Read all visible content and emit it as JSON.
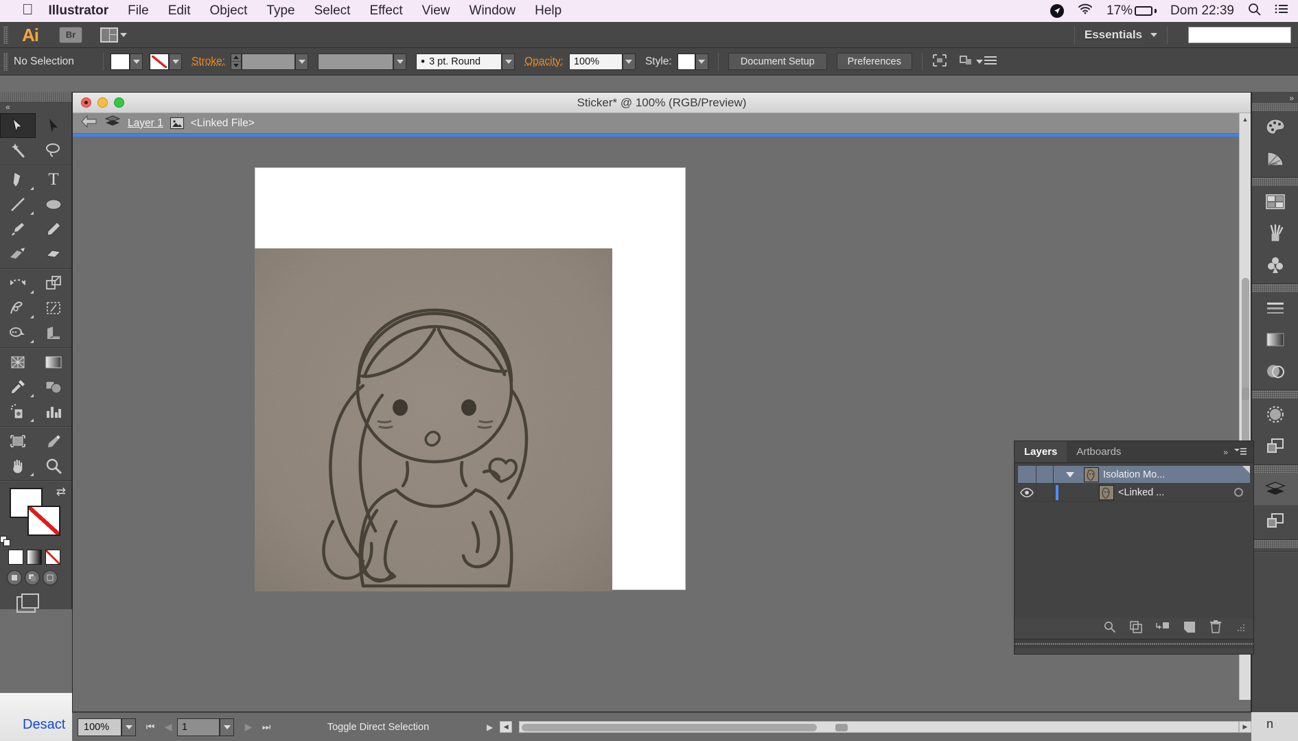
{
  "menubar": {
    "apple_icon": "apple-logo",
    "app_name": "Illustrator",
    "items": [
      "File",
      "Edit",
      "Object",
      "Type",
      "Select",
      "Effect",
      "View",
      "Window",
      "Help"
    ],
    "status": {
      "location_icon": "location-arrow-icon",
      "wifi_icon": "wifi-icon",
      "battery_percent": "17%",
      "battery_level": 17,
      "clock": "Dom 22:39",
      "search_icon": "search-icon",
      "notification_icon": "notification-center-icon"
    }
  },
  "appbar": {
    "logo": "Ai",
    "bridge_label": "Br",
    "arrange_icon": "arrange-documents-icon",
    "workspace": "Essentials",
    "workspace_caret": "chevron-down-icon",
    "search_value": "",
    "search_placeholder": ""
  },
  "controlbar": {
    "selection_status": "No Selection",
    "fill_label": "fill-swatch",
    "stroke_label": "Stroke:",
    "stroke_weight": "",
    "stroke_profile": "",
    "brush_definition": "3 pt. Round",
    "opacity_label": "Opacity:",
    "opacity_value": "100%",
    "style_label": "Style:",
    "document_setup": "Document Setup",
    "preferences": "Preferences",
    "align_icon": "align-icon",
    "transform_icon": "transform-icon",
    "panel_menu_icon": "panel-menu-icon"
  },
  "toolbar": {
    "collapse_icon": "double-chevron-left-icon",
    "tools": [
      {
        "name": "selection-tool",
        "selected": true
      },
      {
        "name": "direct-selection-tool",
        "selected": false
      },
      {
        "name": "magic-wand-tool",
        "selected": false
      },
      {
        "name": "lasso-tool",
        "selected": false
      },
      {
        "name": "pen-tool",
        "selected": false
      },
      {
        "name": "type-tool",
        "selected": false
      },
      {
        "name": "line-segment-tool",
        "selected": false
      },
      {
        "name": "ellipse-tool",
        "selected": false
      },
      {
        "name": "paintbrush-tool",
        "selected": false
      },
      {
        "name": "pencil-tool",
        "selected": false
      },
      {
        "name": "blob-brush-tool",
        "selected": false
      },
      {
        "name": "eraser-tool",
        "selected": false
      },
      {
        "name": "rotate-tool",
        "selected": false
      },
      {
        "name": "scale-tool",
        "selected": false
      },
      {
        "name": "width-tool",
        "selected": false
      },
      {
        "name": "free-transform-tool",
        "selected": false
      },
      {
        "name": "shape-builder-tool",
        "selected": false
      },
      {
        "name": "perspective-grid-tool",
        "selected": false
      },
      {
        "name": "mesh-tool",
        "selected": false
      },
      {
        "name": "gradient-tool",
        "selected": false
      },
      {
        "name": "eyedropper-tool",
        "selected": false
      },
      {
        "name": "blend-tool",
        "selected": false
      },
      {
        "name": "symbol-sprayer-tool",
        "selected": false
      },
      {
        "name": "column-graph-tool",
        "selected": false
      },
      {
        "name": "artboard-tool",
        "selected": false
      },
      {
        "name": "slice-tool",
        "selected": false
      },
      {
        "name": "hand-tool",
        "selected": false
      },
      {
        "name": "zoom-tool",
        "selected": false
      }
    ],
    "fill_color": "#ffffff",
    "stroke_color": "none",
    "swap_icon": "swap-fill-stroke-icon",
    "default_icon": "default-fill-stroke-icon",
    "color_modes": [
      "color-swatch",
      "gradient-swatch",
      "none-swatch"
    ],
    "screen_modes": [
      "normal-screen-mode",
      "full-screen-menu-mode",
      "full-screen-mode"
    ],
    "fullscreen_icon": "change-screen-mode-icon"
  },
  "document": {
    "title": "Sticker* @ 100% (RGB/Preview)",
    "traffic_lights": [
      "close-button",
      "minimize-button",
      "zoom-button"
    ],
    "breadcrumb": {
      "back_icon": "back-arrow-icon",
      "layers_icon": "layers-stack-icon",
      "layer_name": "Layer 1",
      "file_icon": "linked-image-icon",
      "object_name": "<Linked File>"
    },
    "artwork_description": "pencil sketch of a chibi girl blowing a heart kiss"
  },
  "layers_panel": {
    "tabs": [
      {
        "label": "Layers",
        "active": true
      },
      {
        "label": "Artboards",
        "active": false
      }
    ],
    "collapse_icon": "double-chevron-right-icon",
    "menu_icon": "panel-menu-icon",
    "rows": [
      {
        "name": "Isolation Mo...",
        "selected": true,
        "expanded": true,
        "visible": false,
        "has_target": false,
        "thumbnail": "sketch-thumbnail"
      },
      {
        "name": "<Linked ...",
        "selected": false,
        "expanded": false,
        "visible": true,
        "has_target": true,
        "thumbnail": "sketch-thumbnail"
      }
    ],
    "footer_icons": [
      "locate-object-icon",
      "make-clipping-mask-icon",
      "make-release-sublayer-icon",
      "create-new-layer-icon",
      "delete-selection-icon",
      "resize-grip-icon"
    ]
  },
  "right_dock": {
    "collapse_icon": "double-chevron-right-icon",
    "icons": [
      "color-palette-icon",
      "color-guide-icon",
      "swatches-icon",
      "brushes-icon",
      "symbols-icon",
      "stroke-icon",
      "gradient-icon",
      "transparency-icon",
      "appearance-icon",
      "graphic-styles-icon",
      "layers-icon",
      "artboards-icon"
    ]
  },
  "status_bar": {
    "zoom_level": "100%",
    "zoom_caret": "chevron-down-icon",
    "first_page_icon": "first-artboard-icon",
    "prev_page_icon": "previous-artboard-icon",
    "page_number": "1",
    "page_caret": "chevron-down-icon",
    "next_page_icon": "next-artboard-icon",
    "last_page_icon": "last-artboard-icon",
    "status_text": "Toggle Direct Selection",
    "status_caret": "right-arrow-icon"
  },
  "desktop": {
    "left_label": "Desact",
    "right_label": "n"
  },
  "colors": {
    "menubar_bg": "#f6e9f7",
    "app_chrome": "#474747",
    "canvas_bg": "#6e6e6e",
    "accent_orange": "#f08a1e",
    "selection_blue": "#3d84e8",
    "layer_selected": "#6c7b91",
    "ai_logo": "#f7a738"
  }
}
